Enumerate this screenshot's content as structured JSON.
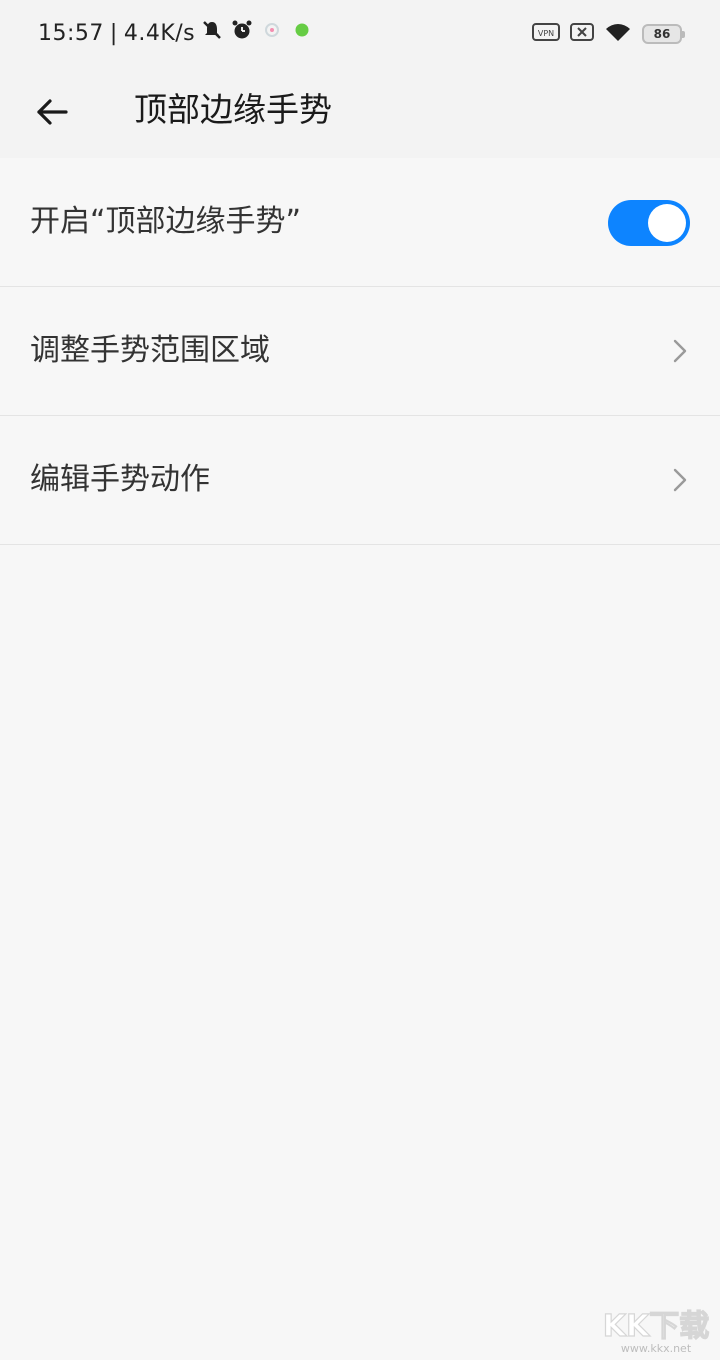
{
  "status_bar": {
    "time": "15:57",
    "separator": "|",
    "net_speed": "4.4K/s",
    "battery_level": "86",
    "icons_left": [
      "mute-bell-icon",
      "alarm-icon",
      "app-notification-icon",
      "green-dot-icon"
    ],
    "icons_right": [
      "vpn-icon",
      "sim-icon",
      "wifi-icon",
      "battery-icon"
    ]
  },
  "header": {
    "title": "顶部边缘手势"
  },
  "settings": {
    "items": [
      {
        "label": "开启“顶部边缘手势”",
        "control": "toggle",
        "enabled": true
      },
      {
        "label": "调整手势范围区域",
        "control": "chevron"
      },
      {
        "label": "编辑手势动作",
        "control": "chevron"
      }
    ]
  },
  "watermark": {
    "brand": "KK下载",
    "site": "www.kkx.net"
  },
  "colors": {
    "accent": "#0d84ff",
    "background": "#f7f7f7",
    "header_bg": "#f3f3f3",
    "text_primary": "#1a1a1a",
    "text_secondary": "#333333",
    "divider": "#e4e4e4"
  }
}
